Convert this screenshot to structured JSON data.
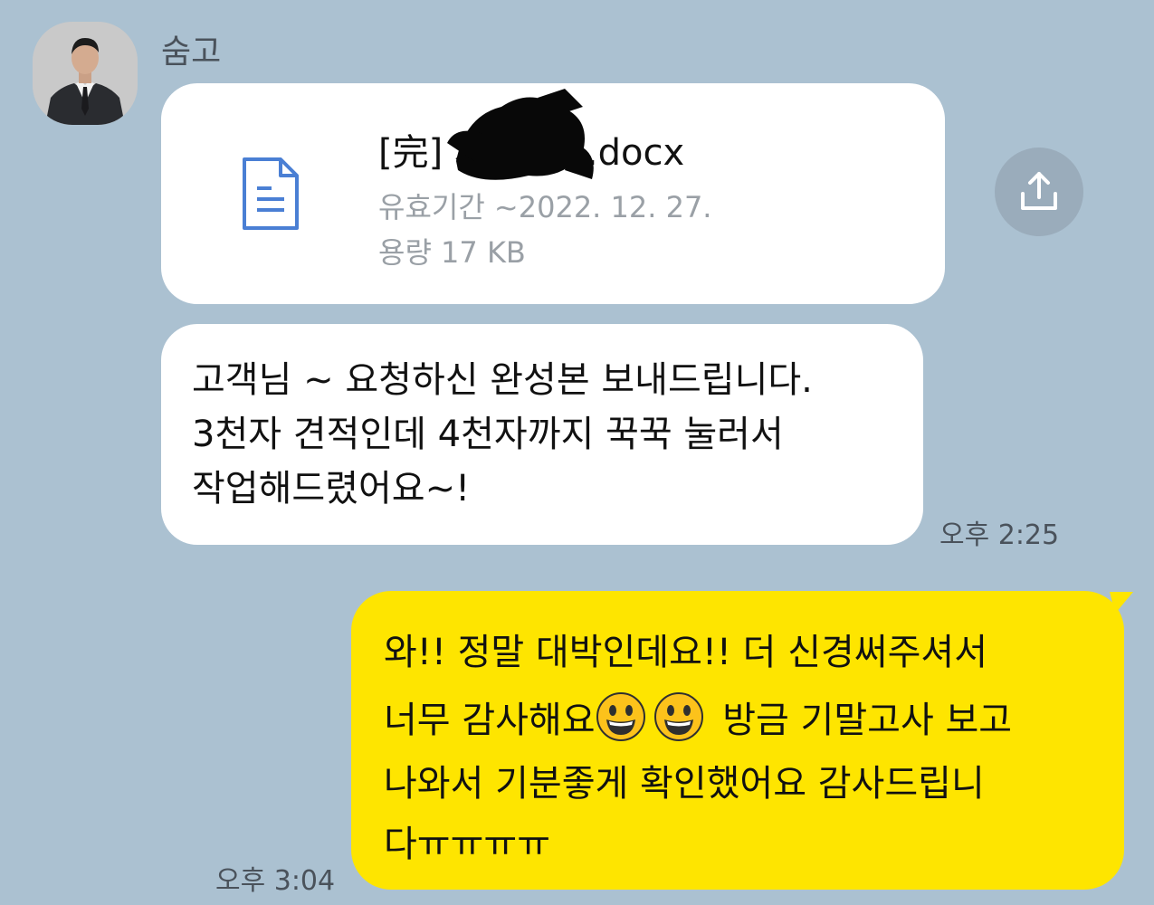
{
  "chat": {
    "sender_name": "숨고",
    "file_message": {
      "file_name": "[完]                    사_채용).docx",
      "expiry_text": "유효기간 ~2022. 12. 27.",
      "size_text": "용량  17 KB",
      "icon": "document-icon",
      "share_icon": "share-upload-icon"
    },
    "text_message": {
      "lines": [
        "고객님 ~ 요청하신 완성본 보내드립니다.",
        "3천자 견적인데 4천자까지 꾹꾹 눌러서",
        "작업해드렸어요~!"
      ],
      "time": "오후 2:25"
    },
    "my_message": {
      "line1": "와!! 정말 대박인데요!! 더 신경써주셔서",
      "line2_text": "너무 감사해요",
      "line2_after": " 방금 기말고사 보고",
      "emoji": "smiling-face-emoji",
      "line3": "나와서 기분좋게 확인했어요 감사드립니",
      "line4": "다ㅠㅠㅠㅠ",
      "time": "오후 3:04"
    }
  },
  "colors": {
    "background": "#abc1d1",
    "my_bubble": "#fee500",
    "other_bubble": "#ffffff",
    "file_icon": "#4a7fd4"
  }
}
